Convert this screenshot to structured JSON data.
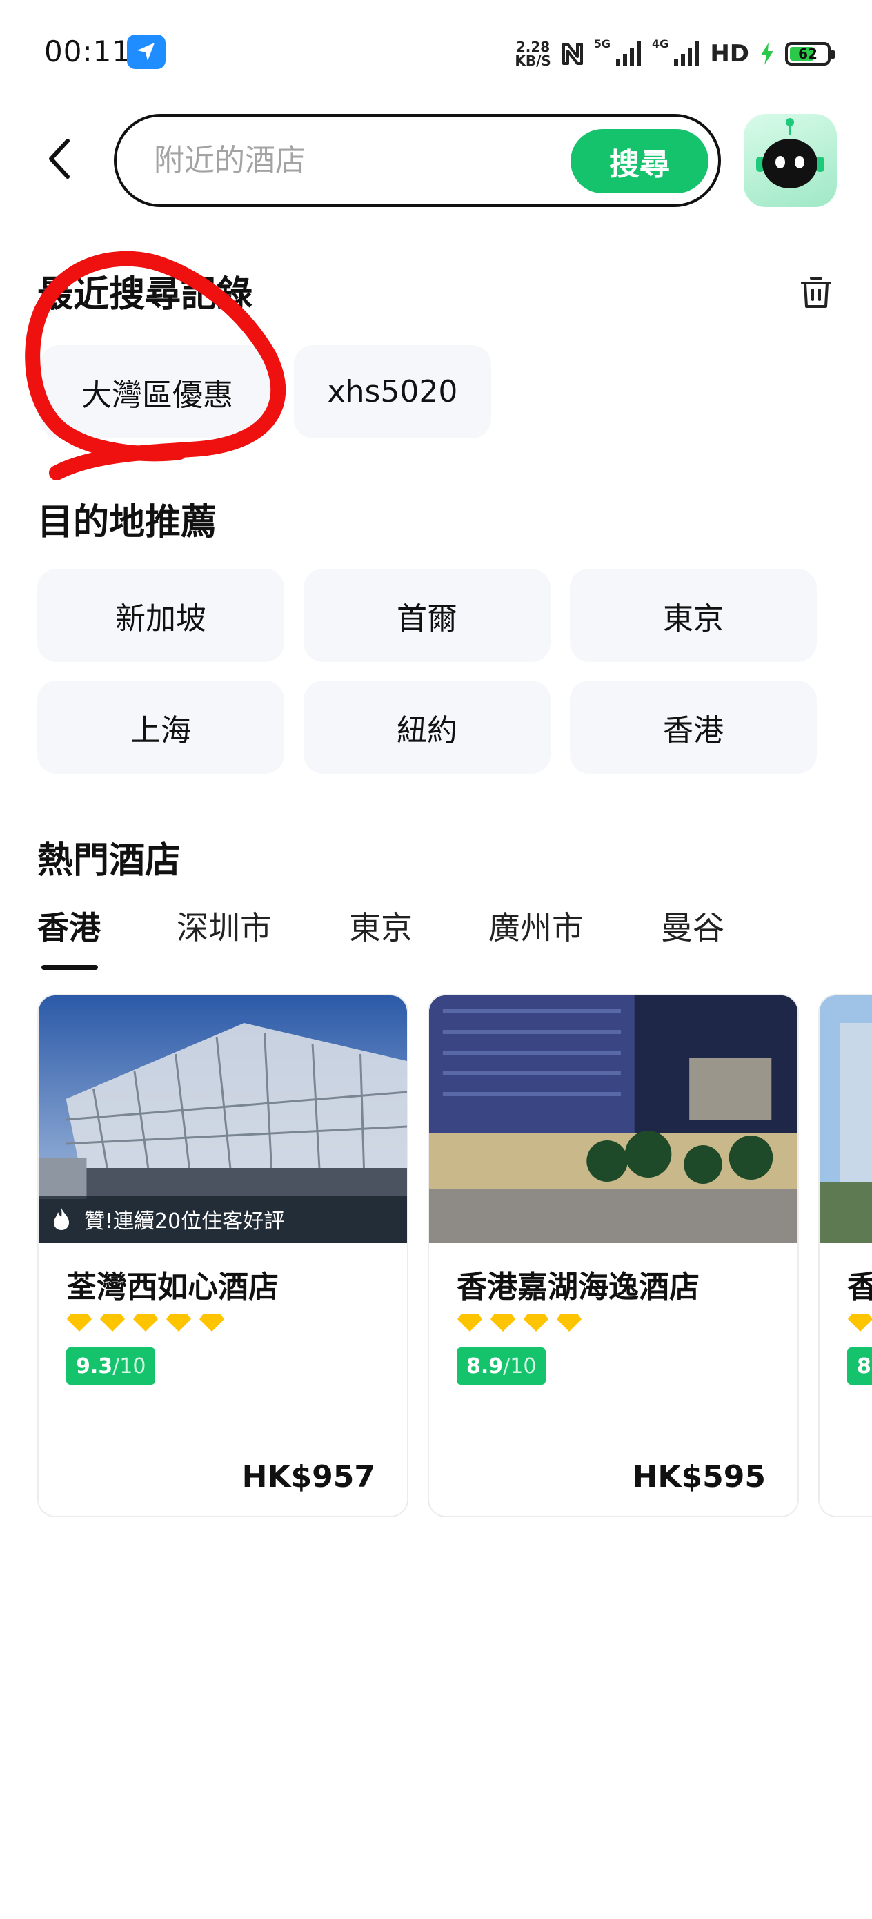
{
  "status": {
    "time": "00:11",
    "net_speed_value": "2.28",
    "net_speed_unit": "KB/S",
    "signal_1": "5G",
    "signal_2": "4G",
    "hd": "HD",
    "battery": "62"
  },
  "search": {
    "placeholder": "附近的酒店",
    "button_label": "搜尋"
  },
  "recent": {
    "title": "最近搜尋記錄",
    "items": [
      "大灣區優惠",
      "xhs5020"
    ]
  },
  "destinations": {
    "title": "目的地推薦",
    "items": [
      "新加坡",
      "首爾",
      "東京",
      "上海",
      "紐約",
      "香港"
    ]
  },
  "hot_hotels": {
    "title": "熱門酒店",
    "tabs": [
      "香港",
      "深圳市",
      "東京",
      "廣州市",
      "曼谷"
    ],
    "active_tab": "香港",
    "cards": [
      {
        "badge": "贊!連續20位住客好評",
        "name": "荃灣西如心酒店",
        "stars": 5,
        "score": "9.3",
        "score_max": "/10",
        "price": "HK$957"
      },
      {
        "badge": "",
        "name": "香港嘉湖海逸酒店",
        "stars": 4,
        "score": "8.9",
        "score_max": "/10",
        "price": "HK$595"
      },
      {
        "name": "香",
        "score": "8."
      }
    ]
  },
  "colors": {
    "accent": "#14c36b",
    "star": "#ffc400",
    "chip_bg": "#f5f7fa",
    "annotation": "#ef1010"
  }
}
